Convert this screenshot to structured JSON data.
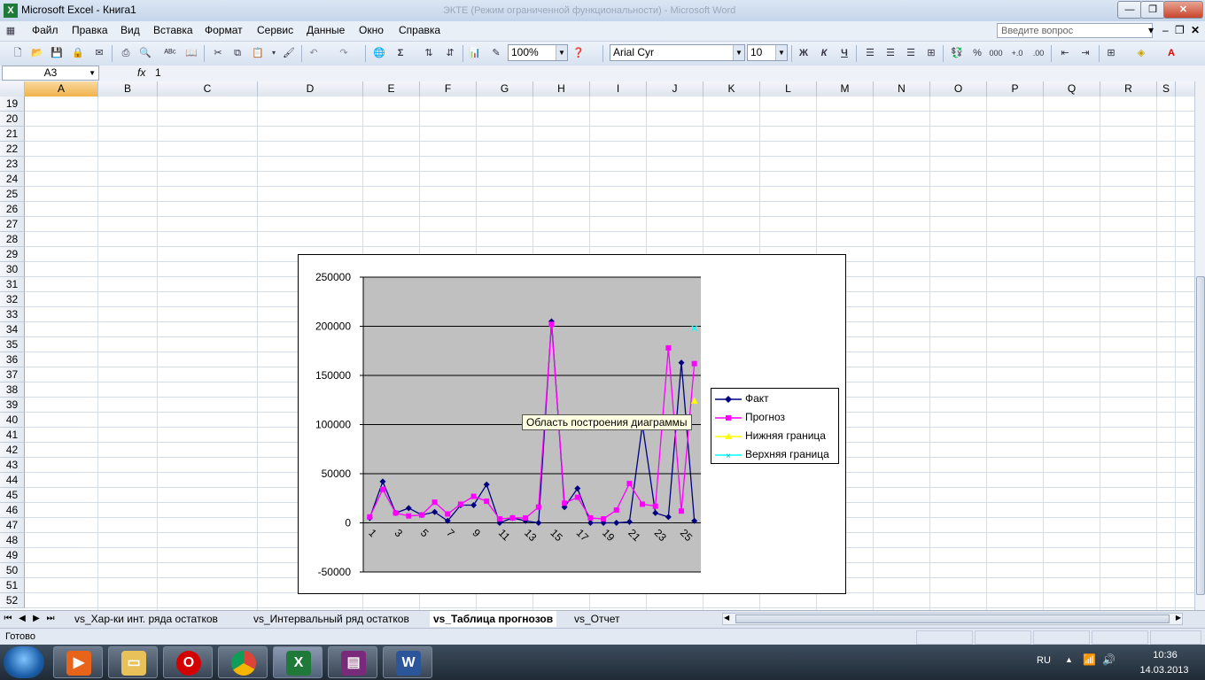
{
  "window": {
    "title": "Microsoft Excel - Книга1",
    "background_title": "ЭКТЕ (Режим ограниченной функциональности) - Microsoft Word"
  },
  "menu": [
    "Файл",
    "Правка",
    "Вид",
    "Вставка",
    "Формат",
    "Сервис",
    "Данные",
    "Окно",
    "Справка"
  ],
  "help_placeholder": "Введите вопрос",
  "toolbar": {
    "zoom": "100%",
    "font": "Arial Cyr",
    "size": "10"
  },
  "formula": {
    "cell": "A3",
    "fx": "fx",
    "value": "1"
  },
  "columns": [
    "A",
    "B",
    "C",
    "D",
    "E",
    "F",
    "G",
    "H",
    "I",
    "J",
    "K",
    "L",
    "M",
    "N",
    "O",
    "P",
    "Q",
    "R",
    "S"
  ],
  "rows": [
    "19",
    "20",
    "21",
    "22",
    "23",
    "24",
    "25",
    "26",
    "27",
    "28",
    "29",
    "30",
    "31",
    "32",
    "33",
    "34",
    "35",
    "36",
    "37",
    "38",
    "39",
    "40",
    "41",
    "42",
    "43",
    "44",
    "45",
    "46",
    "47",
    "48",
    "49",
    "50",
    "51",
    "52"
  ],
  "selected_column": "A",
  "chart_data": {
    "type": "line",
    "x": [
      1,
      2,
      3,
      4,
      5,
      6,
      7,
      8,
      9,
      10,
      11,
      12,
      13,
      14,
      15,
      16,
      17,
      18,
      19,
      20,
      21,
      22,
      23,
      24,
      25,
      26
    ],
    "x_tick_labels": [
      "1",
      "3",
      "5",
      "7",
      "9",
      "11",
      "13",
      "15",
      "17",
      "19",
      "21",
      "23",
      "25"
    ],
    "ylim": [
      -50000,
      250000
    ],
    "y_ticks": [
      "-50000",
      "0",
      "50000",
      "100000",
      "150000",
      "200000",
      "250000"
    ],
    "grid": "horizontal major",
    "plot_background": "#c0c0c0",
    "legend_position": "right",
    "series": [
      {
        "name": "Факт",
        "color": "#000080",
        "marker": "diamond",
        "values": [
          5000,
          42000,
          10000,
          15000,
          8000,
          11000,
          2000,
          18000,
          18000,
          39000,
          0,
          5000,
          2000,
          0,
          205000,
          16000,
          35000,
          0,
          0,
          0,
          1000,
          100000,
          10000,
          6000,
          163000,
          2000
        ]
      },
      {
        "name": "Прогноз",
        "color": "#ff00ff",
        "marker": "square",
        "values": [
          6000,
          34000,
          10000,
          7000,
          8000,
          21000,
          9000,
          19000,
          27000,
          22000,
          4000,
          5000,
          5000,
          16000,
          202000,
          20000,
          26000,
          5000,
          4000,
          13000,
          40000,
          19000,
          17000,
          178000,
          12000,
          162000
        ]
      },
      {
        "name": "Нижняя граница",
        "color": "#ffff00",
        "marker": "triangle",
        "values": [
          null,
          null,
          null,
          null,
          null,
          null,
          null,
          null,
          null,
          null,
          null,
          null,
          null,
          null,
          null,
          null,
          null,
          null,
          null,
          null,
          null,
          null,
          null,
          null,
          null,
          124000
        ]
      },
      {
        "name": "Верхняя граница",
        "color": "#00ffff",
        "marker": "x",
        "values": [
          null,
          null,
          null,
          null,
          null,
          null,
          null,
          null,
          null,
          null,
          null,
          null,
          null,
          null,
          null,
          null,
          null,
          null,
          null,
          null,
          null,
          null,
          null,
          null,
          null,
          198000
        ]
      }
    ]
  },
  "chart_tooltip": "Область построения диаграммы",
  "sheets": [
    "vs_Хар-ки инт. ряда остатков",
    "vs_Интервальный ряд остатков",
    "vs_Таблица прогнозов",
    "vs_Отчет"
  ],
  "active_sheet": "vs_Таблица прогнозов",
  "status": "Готово",
  "tray": {
    "lang": "RU",
    "time": "10:36",
    "date": "14.03.2013"
  }
}
